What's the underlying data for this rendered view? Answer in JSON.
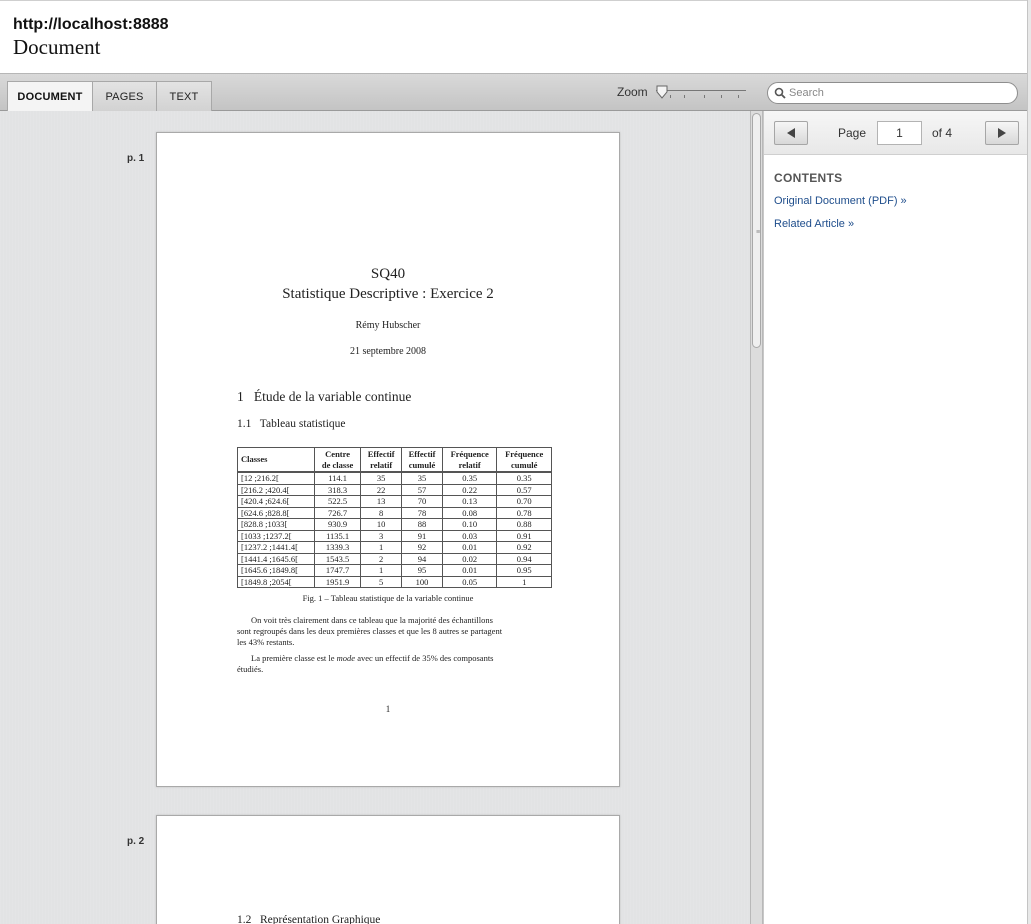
{
  "header": {
    "url": "http://localhost:8888",
    "title": "Document"
  },
  "toolbar": {
    "tabs": [
      {
        "label": "DOCUMENT",
        "active": true
      },
      {
        "label": "PAGES",
        "active": false
      },
      {
        "label": "TEXT",
        "active": false
      }
    ],
    "zoom_label": "Zoom",
    "zoom_level": 0,
    "search_placeholder": "Search"
  },
  "sidebar": {
    "page_word": "Page",
    "current_page": "1",
    "of_total": "of 4",
    "contents_heading": "CONTENTS",
    "links": [
      "Original Document (PDF) »",
      "Related Article »"
    ]
  },
  "pages": [
    {
      "label": "p. 1"
    },
    {
      "label": "p. 2"
    }
  ],
  "page1": {
    "title": "SQ40",
    "subtitle": "Statistique Descriptive : Exercice 2",
    "author": "Rémy Hubscher",
    "date": "21 septembre 2008",
    "section": "1   Étude de la variable continue",
    "subsection": "1.1   Tableau statistique",
    "table": {
      "headers": [
        [
          "Classes",
          ""
        ],
        [
          "Centre",
          "de classe"
        ],
        [
          "Effectif",
          "relatif"
        ],
        [
          "Effectif",
          "cumulé"
        ],
        [
          "Fréquence",
          "relatif"
        ],
        [
          "Fréquence",
          "cumulé"
        ]
      ],
      "rows": [
        [
          "[12 ;216.2[",
          "114.1",
          "35",
          "35",
          "0.35",
          "0.35"
        ],
        [
          "[216.2 ;420.4[",
          "318.3",
          "22",
          "57",
          "0.22",
          "0.57"
        ],
        [
          "[420.4 ;624.6[",
          "522.5",
          "13",
          "70",
          "0.13",
          "0.70"
        ],
        [
          "[624.6 ;828.8[",
          "726.7",
          "8",
          "78",
          "0.08",
          "0.78"
        ],
        [
          "[828.8 ;1033[",
          "930.9",
          "10",
          "88",
          "0.10",
          "0.88"
        ],
        [
          "[1033 ;1237.2[",
          "1135.1",
          "3",
          "91",
          "0.03",
          "0.91"
        ],
        [
          "[1237.2 ;1441.4[",
          "1339.3",
          "1",
          "92",
          "0.01",
          "0.92"
        ],
        [
          "[1441.4 ;1645.6[",
          "1543.5",
          "2",
          "94",
          "0.02",
          "0.94"
        ],
        [
          "[1645.6 ;1849.8[",
          "1747.7",
          "1",
          "95",
          "0.01",
          "0.95"
        ],
        [
          "[1849.8 ;2054[",
          "1951.9",
          "5",
          "100",
          "0.05",
          "1"
        ]
      ]
    },
    "caption": "Fig. 1 – Tableau statistique de la variable continue",
    "para1_line1": "On voit très clairement dans ce tableau que la majorité des échantillons",
    "para1_line2": "sont regroupés dans les deux premières classes et que les 8 autres se partagent",
    "para1_line3": "les 43% restants.",
    "para2_pre": "La première classe est le ",
    "para2_em": "mode",
    "para2_post": " avec un effectif de 35% des composants",
    "para2_line2": "étudiés.",
    "page_number": "1"
  },
  "page2": {
    "section": "1.2   Représentation Graphique"
  }
}
